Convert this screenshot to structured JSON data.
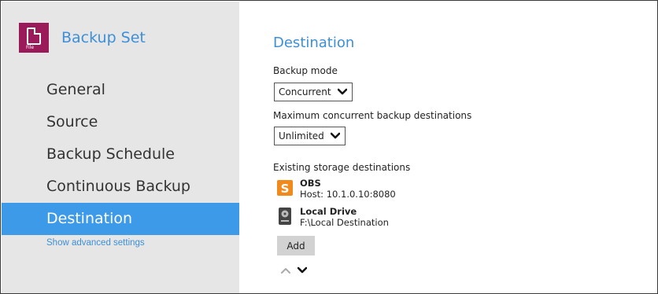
{
  "sidebar": {
    "app_title": "Backup Set",
    "app_icon_tag": "File",
    "items": [
      {
        "label": "General"
      },
      {
        "label": "Source"
      },
      {
        "label": "Backup Schedule"
      },
      {
        "label": "Continuous Backup"
      },
      {
        "label": "Destination",
        "active": true
      }
    ],
    "advanced_link": "Show advanced settings"
  },
  "main": {
    "title": "Destination",
    "backup_mode_label": "Backup mode",
    "backup_mode_value": "Concurrent",
    "max_dest_label": "Maximum concurrent backup destinations",
    "max_dest_value": "Unlimited",
    "existing_label": "Existing storage destinations",
    "destinations": [
      {
        "name": "OBS",
        "detail": "Host: 10.1.0.10:8080",
        "icon": "obs-icon"
      },
      {
        "name": "Local Drive",
        "detail": "F:\\Local Destination",
        "icon": "local-drive-icon"
      }
    ],
    "add_label": "Add"
  },
  "colors": {
    "accent": "#3d9ae8",
    "brand_icon": "#9b1b5a",
    "obs_orange": "#f08a1c",
    "sidebar_bg": "#e6e6e6"
  }
}
